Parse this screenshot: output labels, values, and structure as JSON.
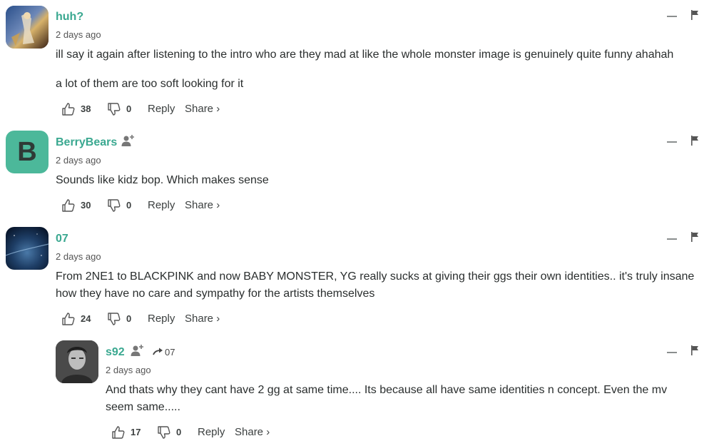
{
  "comments": [
    {
      "username": "huh?",
      "timestamp": "2 days ago",
      "lines": [
        "ill say it again after listening to the intro who are they mad at like the whole monster image is genuinely quite funny ahahah",
        "a lot of them are too soft looking for it"
      ],
      "upvotes": "38",
      "downvotes": "0",
      "reply_label": "Reply",
      "share_label": "Share ›"
    },
    {
      "username": "BerryBears",
      "avatar_letter": "B",
      "timestamp": "2 days ago",
      "lines": [
        "Sounds like kidz bop. Which makes sense"
      ],
      "upvotes": "30",
      "downvotes": "0",
      "reply_label": "Reply",
      "share_label": "Share ›"
    },
    {
      "username": "07",
      "timestamp": "2 days ago",
      "lines": [
        "From 2NE1 to BLACKPINK and now BABY MONSTER, YG really sucks at giving their ggs their own identities.. it's truly insane",
        "how they have no care and sympathy for the artists themselves"
      ],
      "upvotes": "24",
      "downvotes": "0",
      "reply_label": "Reply",
      "share_label": "Share ›"
    },
    {
      "username": "s92",
      "reply_to": "07",
      "timestamp": "2 days ago",
      "lines": [
        "And thats why they cant have 2 gg at same time.... Its because all have same identities n concept. Even the mv",
        "seem same....."
      ],
      "upvotes": "17",
      "downvotes": "0",
      "reply_label": "Reply",
      "share_label": "Share ›"
    }
  ],
  "colors": {
    "username": "#3aa890",
    "avatar_b_bg": "#4cb89a",
    "text": "#2a2e2e"
  }
}
